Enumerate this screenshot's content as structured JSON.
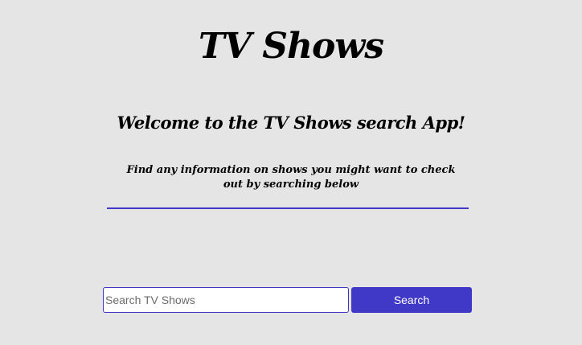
{
  "header": {
    "title": "TV Shows"
  },
  "intro": {
    "welcome": "Welcome to the TV Shows search App!",
    "subtitle": "Find any information on shows you might want to check out by searching below"
  },
  "search": {
    "value": "",
    "placeholder": "Search TV Shows",
    "button_label": "Search"
  },
  "colors": {
    "background": "#e5e5e5",
    "accent": "#4038c7",
    "button_text": "#ffffff"
  }
}
